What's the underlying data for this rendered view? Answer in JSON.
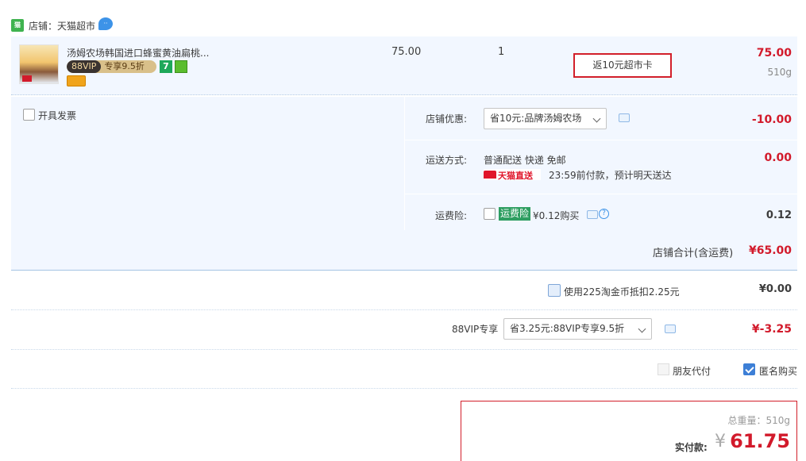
{
  "shop": {
    "label": "店铺：天猫超市",
    "logo_icon": "tmall-supermarket-icon",
    "contact_icon": "wangwang-chat-icon"
  },
  "product": {
    "title": "汤姆农场韩国进口蜂蜜黄油扁桃...",
    "vip_tag_left": "88VIP",
    "vip_tag_right": "专享9.5折",
    "seven_badge": "7",
    "unit_price": "75.00",
    "quantity": "1",
    "rebate_label": "返10元超市卡",
    "subtotal": "75.00",
    "weight": "510g"
  },
  "invoice": {
    "label": "开具发票"
  },
  "shop_discount": {
    "label": "店铺优惠:",
    "selected": "省10元:品牌汤姆农场",
    "value": "-10.00"
  },
  "shipping": {
    "label": "运送方式:",
    "method": "普通配送 快递 免邮",
    "tmall_badge": "天猫直送",
    "delivery_note": "23:59前付款，预计明天送达",
    "value": "0.00"
  },
  "insurance": {
    "label": "运费险:",
    "badge": "运费险",
    "price_text": "¥0.12购买",
    "value": "0.12"
  },
  "shop_total": {
    "label": "店铺合计(含运费)",
    "value": "¥65.00"
  },
  "coins": {
    "label": "使用225淘金币抵扣2.25元",
    "value": "¥0.00"
  },
  "vip_discount": {
    "label": "88VIP专享",
    "selected": "省3.25元:88VIP专享9.5折",
    "value": "¥-3.25"
  },
  "options": {
    "friend_pay": "朋友代付",
    "anonymous": "匿名购买"
  },
  "summary": {
    "weight_label": "总重量：",
    "weight_value": "510g",
    "pay_label": "实付款:",
    "currency": "¥",
    "pay_value": "61.75"
  },
  "colors": {
    "accent_red": "#d21a2b",
    "row_bg": "#f2f7ff",
    "checkbox_blue": "#3d7fd6"
  }
}
